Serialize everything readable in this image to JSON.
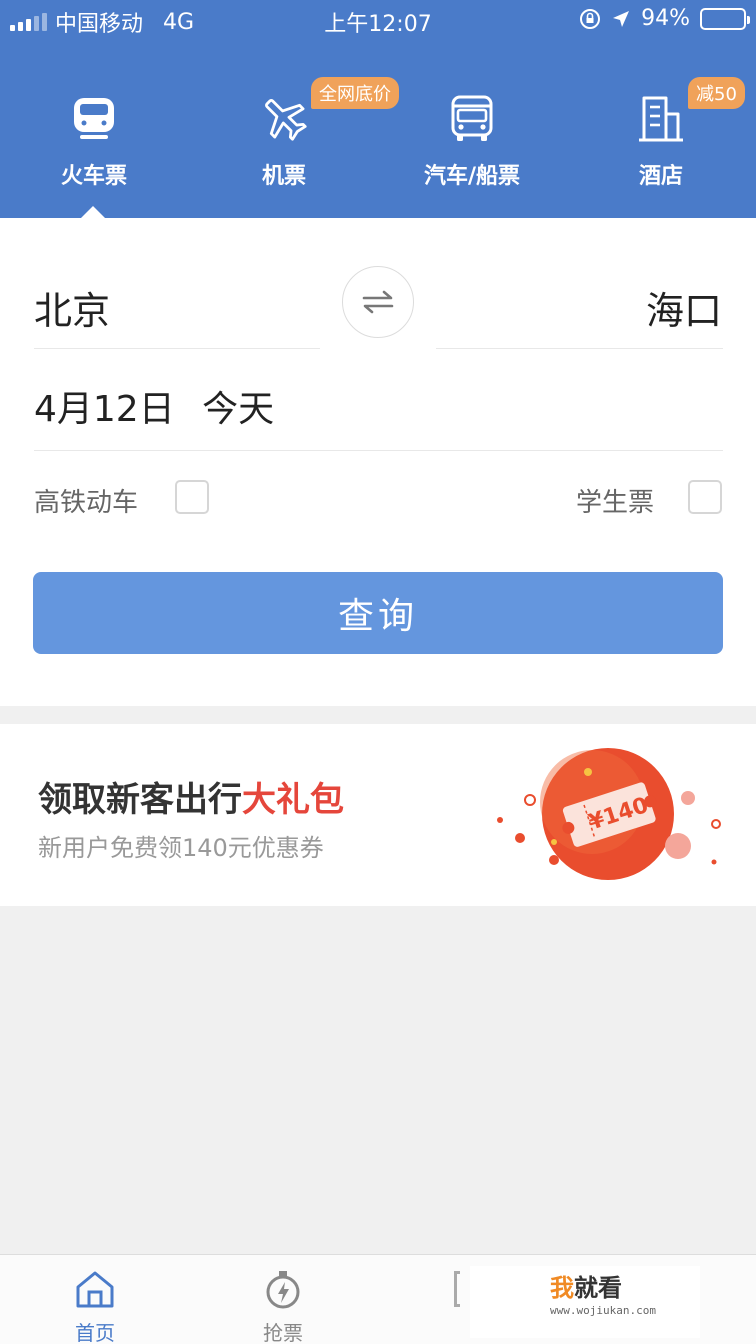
{
  "status_bar": {
    "carrier": "中国移动",
    "network": "4G",
    "time": "上午12:07",
    "battery": "94%",
    "battery_level": 0.94
  },
  "categories": [
    {
      "label": "火车票",
      "icon": "train-icon",
      "active": true,
      "badge": ""
    },
    {
      "label": "机票",
      "icon": "airplane-icon",
      "active": false,
      "badge": "全网底价"
    },
    {
      "label": "汽车/船票",
      "icon": "bus-icon",
      "active": false,
      "badge": ""
    },
    {
      "label": "酒店",
      "icon": "hotel-building-icon",
      "active": false,
      "badge": "减50"
    }
  ],
  "search_form": {
    "from_city": "北京",
    "to_city": "海口",
    "date": "4月12日",
    "date_relative": "今天",
    "option_high_speed": "高铁动车",
    "option_high_speed_checked": false,
    "option_student": "学生票",
    "option_student_checked": false,
    "query_button": "查询"
  },
  "promo": {
    "title_prefix": "领取新客出行",
    "title_highlight": "大礼包",
    "subtitle": "新用户免费领140元优惠券",
    "coupon_text": "¥140"
  },
  "tabbar": {
    "items": [
      {
        "label": "首页",
        "icon": "home-icon",
        "active": true
      },
      {
        "label": "抢票",
        "icon": "stopwatch-icon",
        "active": false
      }
    ]
  },
  "watermark": {
    "logo_text_orange": "我",
    "logo_text_dark": "就看",
    "url": "www.wojiukan.com"
  },
  "colors": {
    "header_blue": "#4a7bc9",
    "button_blue": "#6496de",
    "badge_orange": "#f0a25a",
    "promo_red": "#e5463b"
  }
}
